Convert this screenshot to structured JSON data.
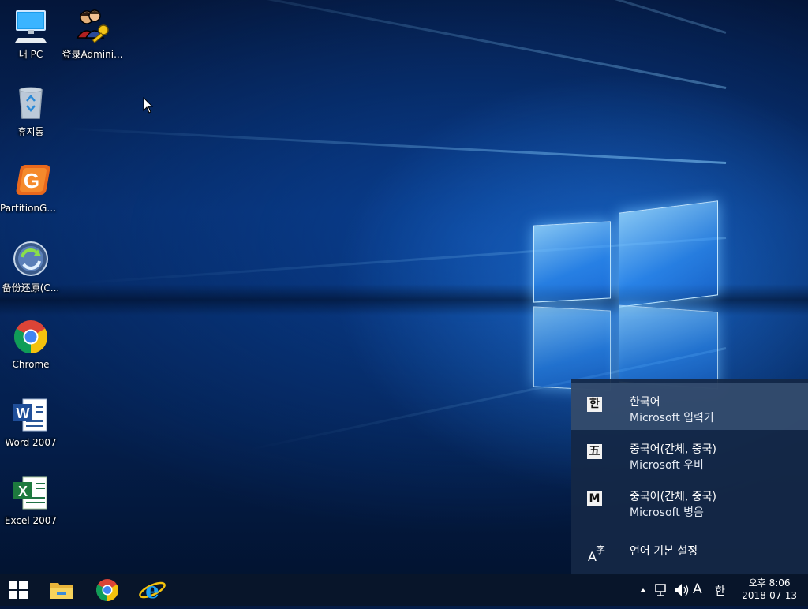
{
  "desktop": {
    "icons": [
      {
        "label": "내 PC",
        "icon": "computer-icon"
      },
      {
        "label": "登录Admini...",
        "icon": "login-users-key-icon"
      },
      {
        "label": "휴지통",
        "icon": "recycle-bin-icon"
      },
      {
        "label": "PartitionGuru",
        "icon": "partitionguru-icon"
      },
      {
        "label": "备份还原(C...",
        "icon": "backup-restore-icon"
      },
      {
        "label": "Chrome",
        "icon": "chrome-icon"
      },
      {
        "label": "Word 2007",
        "icon": "word-icon"
      },
      {
        "label": "Excel 2007",
        "icon": "excel-icon"
      }
    ]
  },
  "language_flyout": {
    "items": [
      {
        "badge": "한",
        "name": "한국어",
        "ime": "Microsoft 입력기",
        "selected": true
      },
      {
        "badge": "五",
        "name": "중국어(간체, 중국)",
        "ime": "Microsoft 우비",
        "selected": false
      },
      {
        "badge": "M",
        "name": "중국어(간체, 중국)",
        "ime": "Microsoft 병음",
        "selected": false
      }
    ],
    "settings_label": "언어 기본 설정",
    "settings_icon": "language-settings-icon"
  },
  "taskbar": {
    "pinned": [
      "start-windows-icon",
      "file-explorer-icon",
      "chrome-icon",
      "internet-explorer-icon"
    ],
    "tray": {
      "input_mode": "A",
      "ime_indicator": "한",
      "time": "오후 8:06",
      "date": "2018-07-13"
    }
  }
}
